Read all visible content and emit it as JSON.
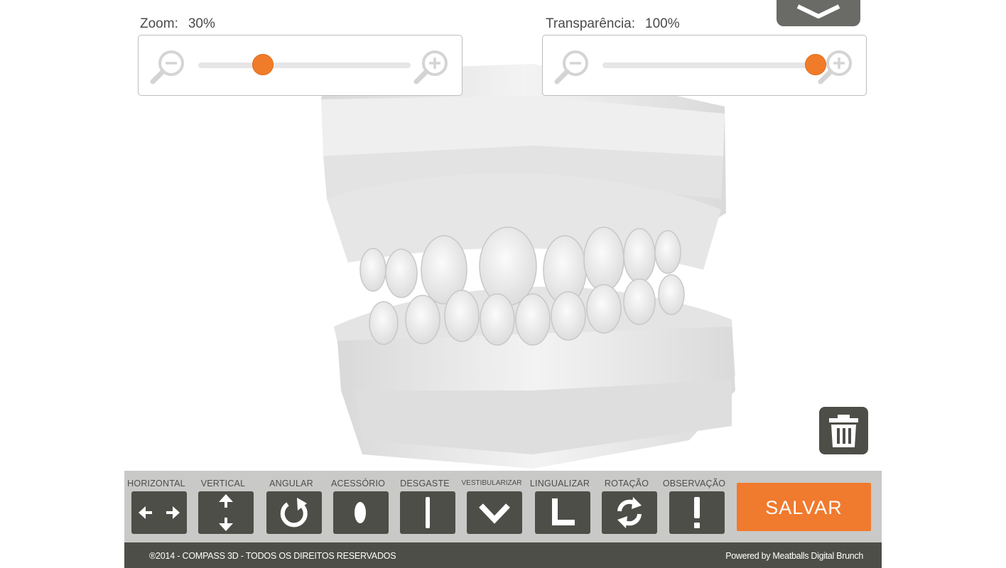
{
  "zoom": {
    "label": "Zoom:",
    "value": "30%",
    "level": 0.3
  },
  "transparency": {
    "label": "Transparência:",
    "value": "100%",
    "level": 1.0
  },
  "toolbar": {
    "tools": [
      {
        "label": "HORIZONTAL",
        "icon": "horizontal-arrows-icon"
      },
      {
        "label": "VERTICAL",
        "icon": "vertical-arrows-icon"
      },
      {
        "label": "ANGULAR",
        "icon": "rotate-cw-icon"
      },
      {
        "label": "ACESSÓRIO",
        "icon": "oval-icon"
      },
      {
        "label": "DESGASTE",
        "icon": "vertical-bar-icon"
      },
      {
        "label": "VESTIBULARIZAR",
        "icon": "chevron-down-icon"
      },
      {
        "label": "LINGUALIZAR",
        "icon": "l-shape-icon"
      },
      {
        "label": "ROTAÇÃO",
        "icon": "refresh-icon"
      },
      {
        "label": "OBSERVAÇÃO",
        "icon": "exclamation-icon"
      }
    ],
    "save_label": "SALVAR"
  },
  "footer": {
    "copyright": "®2014 - COMPASS 3D - TODOS OS DIREITOS RESERVADOS",
    "powered": "Powered by Meatballs Digital Brunch"
  },
  "colors": {
    "accent": "#f07a2e",
    "dark": "#4e4e48",
    "toolbar_bg": "#c9c9c7"
  }
}
